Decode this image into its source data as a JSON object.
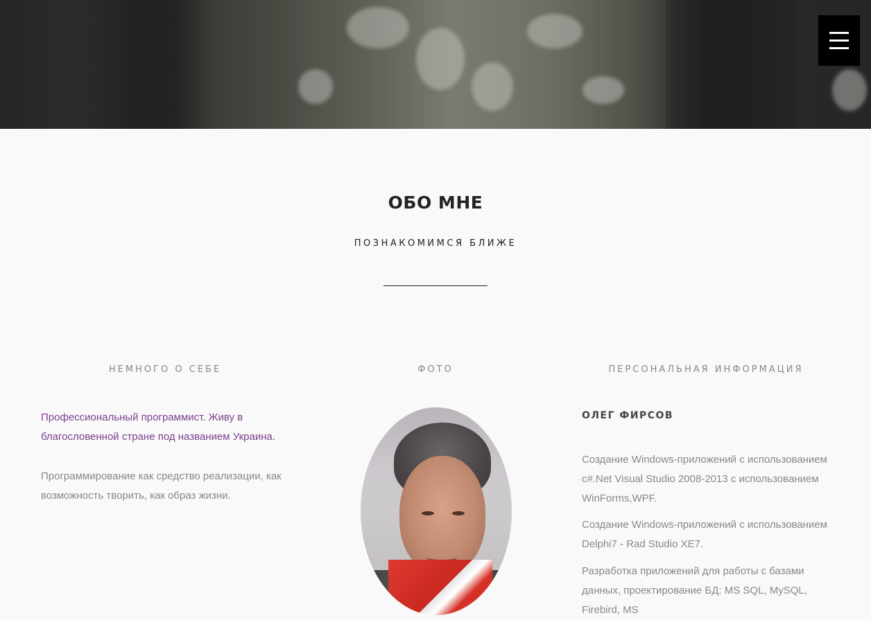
{
  "hero": {
    "menu_icon": "hamburger-menu-icon"
  },
  "about": {
    "title": "ОБО МНЕ",
    "subtitle": "ПОЗНАКОМИМСЯ БЛИЖЕ"
  },
  "columns": {
    "about_self": {
      "heading": "НЕМНОГО О СЕБЕ",
      "lead": "Профессиональный программист. Живу в благословенной стране под названием Украина.",
      "body": "Программирование как средство реализации, как возможность творить, как образ жизни."
    },
    "photo": {
      "heading": "ФОТО"
    },
    "personal_info": {
      "heading": "ПЕРСОНАЛЬНАЯ ИНФОРМАЦИЯ",
      "name": "ОЛЕГ ФИРСОВ",
      "paragraphs": [
        "Создание Windows-приложений с использованием c#.Net Visual Studio 2008-2013 с использованием WinForms,WPF.",
        "Создание Windows-приложений с использованием Delphi7 - Rad Studio XE7.",
        "Разработка приложений для работы с базами данных, проектирование БД: MS SQL, MySQL, Firebird, MS"
      ]
    }
  },
  "colors": {
    "accent": "#7b3f8c",
    "text_muted": "#888888",
    "heading": "#222222",
    "menu_bg": "#000000"
  }
}
